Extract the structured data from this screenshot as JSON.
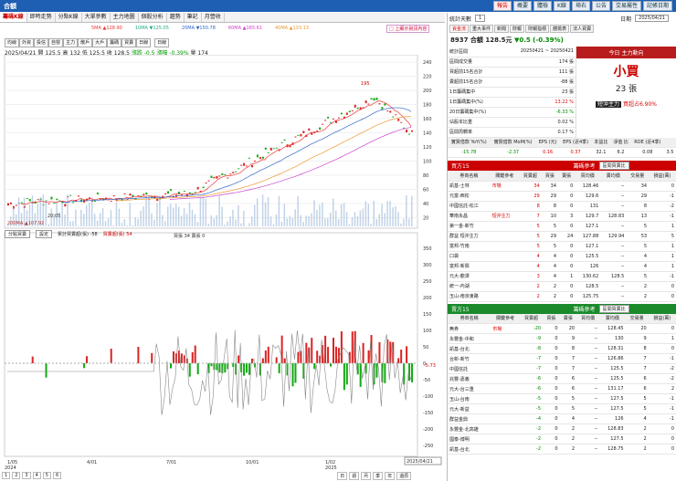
{
  "app": {
    "title": "合額",
    "top_buttons": [
      "報告",
      "概要",
      "體檢",
      "K線",
      "埼右",
      "公告",
      "交易屬性",
      "記帳日期"
    ]
  },
  "left_tabs": [
    "籌碼K線",
    "即時走勢",
    "分點K線",
    "大單參數",
    "主力地圖",
    "個股分析",
    "趨勢",
    "筆記",
    "月營收"
  ],
  "ma_legend": [
    {
      "label": "5MA ▲128.90",
      "color": "#e33"
    },
    {
      "label": "10MA ▼125.05",
      "color": "#2a8"
    },
    {
      "label": "20MA ▼150.78",
      "color": "#36c"
    },
    {
      "label": "60MA ▲165.61",
      "color": "#c4c"
    },
    {
      "label": "40MA ▲133.13",
      "color": "#e93"
    }
  ],
  "ma200": "200MA ▲107.92",
  "check_btn": "□ 上顯示資訊內容",
  "chart_tabs": [
    "均線",
    "外資",
    "投信",
    "自營",
    "主力",
    "散戶",
    "大戶",
    "籌碼",
    "買賣",
    "日線"
  ],
  "period_select": "日線",
  "info_line": {
    "date": "2025/04/21",
    "open": "開 125.5",
    "high": "高 132",
    "low": "低 125.5",
    "close": "收 128.5",
    "change": "漲跌 -0.5",
    "pct": "漲幅 -0.39%",
    "vol": "量 174"
  },
  "price_axis": [
    "240",
    "220",
    "200",
    "180",
    "160",
    "140",
    "120",
    "100",
    "80",
    "60",
    "40",
    "20"
  ],
  "price_peak": "195",
  "price_low": "20.05",
  "low_panel": {
    "select": "分點買賣",
    "button": "設定",
    "l1": "累計買賣超(張) -58",
    "l2": "買賣超(張) 54",
    "l3": "買張 34 賣張 0"
  },
  "low_axis": [
    "350",
    "300",
    "250",
    "200",
    "150",
    "100",
    "50",
    "0",
    "-50",
    "-100",
    "-150",
    "-200",
    "-250"
  ],
  "low_value": "-5.73",
  "x_dates": [
    "1/05",
    "4/01",
    "7/01",
    "10/01",
    "1/02",
    "4/01"
  ],
  "x_years": [
    "2024",
    "2025"
  ],
  "cur_date": "2025/04/21",
  "bottom_btns": [
    "1",
    "2",
    "3",
    "4",
    "5",
    "6",
    "日",
    "週",
    "月",
    "季",
    "年",
    "還原"
  ],
  "right": {
    "stat_label": "統計天數",
    "stat_value": "1",
    "date_label": "日期",
    "date_value": "2025/04/21",
    "tabs": [
      "資金流",
      "重大事件",
      "新聞",
      "財報",
      "財報指標",
      "體檢表",
      "法人買賣"
    ],
    "stock": "8937 合額",
    "price": "128.5元",
    "chg": "▼0.5 (-0.39%)",
    "sum_rows": [
      [
        "統計區間",
        "20250421 ~ 20250421"
      ],
      [
        "區間成交量",
        "174 張"
      ],
      [
        "買超前15名合計",
        "111 張"
      ],
      [
        "賣超前15名合計",
        "-88 張"
      ],
      [
        "1日籌碼集中",
        "23 張"
      ],
      [
        "1日籌碼集中(%)",
        "13.22 %"
      ],
      [
        "20日籌碼集中(%)",
        "-6.33 %"
      ],
      [
        "佔股本比重",
        "0.02 %"
      ],
      [
        "區間周轉率",
        "0.17 %"
      ]
    ],
    "main_force_title": "今日\n主力動向",
    "main_force_word": "小買",
    "main_force_val": "23 張",
    "short_label": "短沖主力",
    "short_val": "買超占6.90%",
    "metrics_head": [
      "實質借款\nYoY(%)",
      "實質借款\nMoM(%)",
      "EPS\n(元)",
      "EPS\n(近4季)",
      "本益比",
      "淨值\n比",
      "ROE\n(近4季)"
    ],
    "metrics_vals": [
      "-15.78",
      "-2.37",
      "0.16",
      "0.37",
      "32.1",
      "6.2",
      "0.08",
      "3.5"
    ],
    "buy_title": "買方15",
    "sell_title": "賣方15",
    "chip_label": "籌碼參考",
    "chip_select": "區間買賣比",
    "cols": [
      "券商名稱",
      "關鍵參考",
      "買賣超",
      "買張",
      "賣張",
      "買均價",
      "賣均價",
      "交易量",
      "損益(萬)"
    ],
    "buy_rows": [
      [
        "凱基-士林",
        "市場",
        "34",
        "34",
        "0",
        "128.46",
        "--",
        "34",
        "0"
      ],
      [
        "元富-西松",
        "",
        "29",
        "29",
        "0",
        "129.6",
        "--",
        "29",
        "-1"
      ],
      [
        "中國信託-松江",
        "",
        "8",
        "8",
        "0",
        "131",
        "--",
        "8",
        "-2"
      ],
      [
        "華南永昌",
        "短沖主力",
        "7",
        "10",
        "3",
        "129.7",
        "128.83",
        "13",
        "-1"
      ],
      [
        "第一金-新竹",
        "",
        "5",
        "5",
        "0",
        "127.1",
        "--",
        "5",
        "1"
      ],
      [
        "群益\n短沖主力",
        "",
        "5",
        "29",
        "24",
        "127.88",
        "129.94",
        "53",
        "5"
      ],
      [
        "富邦-竹南",
        "",
        "5",
        "5",
        "0",
        "127.1",
        "--",
        "5",
        "1"
      ],
      [
        "口袋",
        "",
        "4",
        "4",
        "0",
        "125.5",
        "--",
        "4",
        "1"
      ],
      [
        "富邦-新興",
        "",
        "4",
        "4",
        "0",
        "126",
        "--",
        "4",
        "1"
      ],
      [
        "元大-龍潭",
        "",
        "3",
        "4",
        "1",
        "130.62",
        "128.5",
        "5",
        "-1"
      ],
      [
        "統一-內湖",
        "",
        "2",
        "2",
        "0",
        "128.5",
        "--",
        "2",
        "0"
      ],
      [
        "玉山-南京東路",
        "",
        "2",
        "2",
        "0",
        "125.75",
        "--",
        "2",
        "0"
      ]
    ],
    "sell_rows": [
      [
        "無券",
        "市場",
        "-20",
        "0",
        "20",
        "--",
        "128.45",
        "20",
        "0"
      ],
      [
        "永豐金-中和",
        "",
        "-9",
        "0",
        "9",
        "--",
        "130",
        "9",
        "1"
      ],
      [
        "凱基-台北",
        "",
        "-8",
        "0",
        "8",
        "--",
        "128.31",
        "8",
        "0"
      ],
      [
        "台新-新竹",
        "",
        "-7",
        "0",
        "7",
        "--",
        "126.86",
        "7",
        "-1"
      ],
      [
        "中國信託",
        "",
        "-7",
        "0",
        "7",
        "--",
        "125.5",
        "7",
        "-2"
      ],
      [
        "兆豐-嘉義",
        "",
        "-6",
        "0",
        "6",
        "--",
        "125.5",
        "6",
        "-2"
      ],
      [
        "元大-台三重",
        "",
        "-6",
        "0",
        "6",
        "--",
        "131.17",
        "6",
        "2"
      ],
      [
        "玉山-台南",
        "",
        "-5",
        "0",
        "5",
        "--",
        "127.5",
        "5",
        "-1"
      ],
      [
        "元大-新益",
        "",
        "-5",
        "0",
        "5",
        "--",
        "127.5",
        "5",
        "-1"
      ],
      [
        "群益金鼎",
        "",
        "-4",
        "0",
        "4",
        "--",
        "126",
        "4",
        "-1"
      ],
      [
        "永豐金-北高雄",
        "",
        "-2",
        "0",
        "2",
        "--",
        "128.83",
        "2",
        "0"
      ],
      [
        "國泰-博明",
        "",
        "-2",
        "0",
        "2",
        "--",
        "127.5",
        "2",
        "0"
      ],
      [
        "凱基-台北",
        "",
        "-2",
        "0",
        "2",
        "--",
        "128.75",
        "2",
        "0"
      ]
    ]
  }
}
